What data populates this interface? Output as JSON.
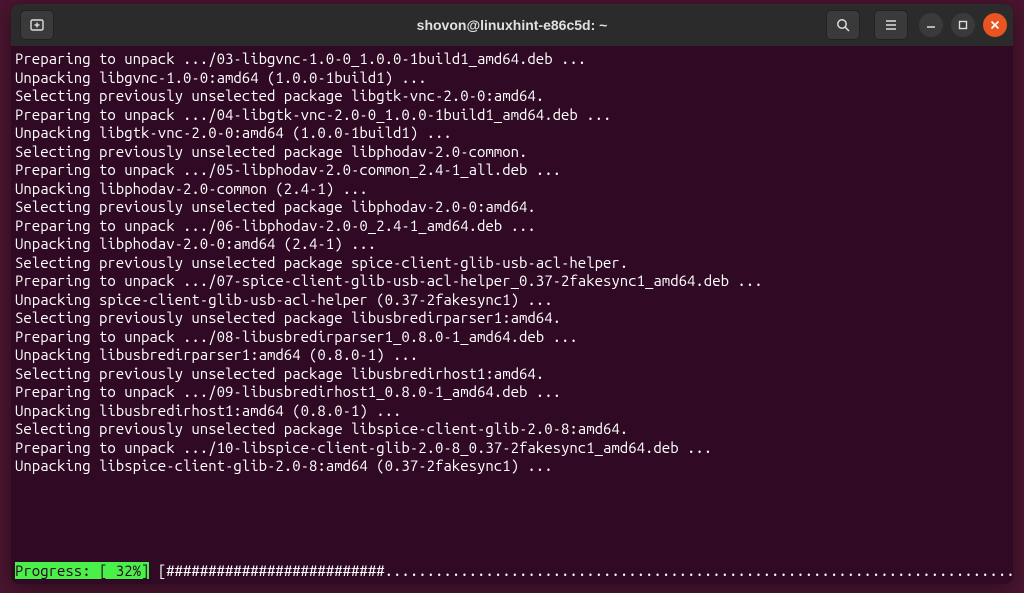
{
  "title": "shovon@linuxhint-e86c5d: ~",
  "colors": {
    "titlebar_bg": "#2b2b2b",
    "terminal_bg": "#300a24",
    "text": "#ffffff",
    "progress_green": "#4af04a",
    "close_orange": "#e95420",
    "desktop_bg": "#4a1530"
  },
  "lines": [
    "Preparing to unpack .../03-libgvnc-1.0-0_1.0.0-1build1_amd64.deb ...",
    "Unpacking libgvnc-1.0-0:amd64 (1.0.0-1build1) ...",
    "Selecting previously unselected package libgtk-vnc-2.0-0:amd64.",
    "Preparing to unpack .../04-libgtk-vnc-2.0-0_1.0.0-1build1_amd64.deb ...",
    "Unpacking libgtk-vnc-2.0-0:amd64 (1.0.0-1build1) ...",
    "Selecting previously unselected package libphodav-2.0-common.",
    "Preparing to unpack .../05-libphodav-2.0-common_2.4-1_all.deb ...",
    "Unpacking libphodav-2.0-common (2.4-1) ...",
    "Selecting previously unselected package libphodav-2.0-0:amd64.",
    "Preparing to unpack .../06-libphodav-2.0-0_2.4-1_amd64.deb ...",
    "Unpacking libphodav-2.0-0:amd64 (2.4-1) ...",
    "Selecting previously unselected package spice-client-glib-usb-acl-helper.",
    "Preparing to unpack .../07-spice-client-glib-usb-acl-helper_0.37-2fakesync1_amd64.deb ...",
    "Unpacking spice-client-glib-usb-acl-helper (0.37-2fakesync1) ...",
    "Selecting previously unselected package libusbredirparser1:amd64.",
    "Preparing to unpack .../08-libusbredirparser1_0.8.0-1_amd64.deb ...",
    "Unpacking libusbredirparser1:amd64 (0.8.0-1) ...",
    "Selecting previously unselected package libusbredirhost1:amd64.",
    "Preparing to unpack .../09-libusbredirhost1_0.8.0-1_amd64.deb ...",
    "Unpacking libusbredirhost1:amd64 (0.8.0-1) ...",
    "Selecting previously unselected package libspice-client-glib-2.0-8:amd64.",
    "Preparing to unpack .../10-libspice-client-glib-2.0-8_0.37-2fakesync1_amd64.deb ...",
    "Unpacking libspice-client-glib-2.0-8:amd64 (0.37-2fakesync1) ...",
    ""
  ],
  "progress": {
    "label_text": "Progress: [ 32%]",
    "percent": 32,
    "bar_open": "[",
    "bar_fill": "##########################",
    "bar_rest": "........................................................................................",
    "bar_close": "]"
  }
}
